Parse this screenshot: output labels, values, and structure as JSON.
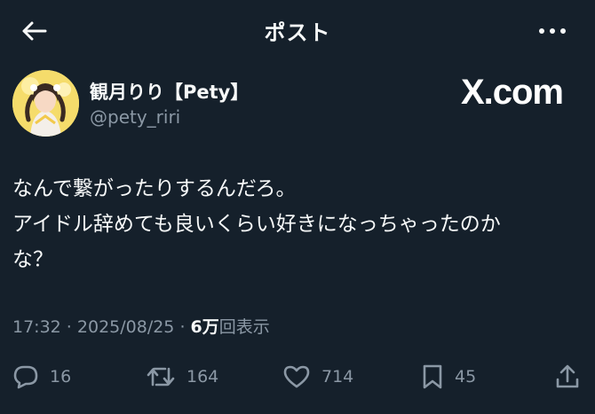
{
  "header": {
    "title": "ポスト",
    "back_icon": "arrow-left-icon",
    "more_icon": "more-horizontal-icon"
  },
  "author": {
    "display_name": "観月りり【Pety】",
    "handle": "@pety_riri",
    "watermark": "X.com"
  },
  "post": {
    "lines": [
      "なんで繋がったりするんだろ。",
      "アイドル辞めても良いくらい好きになっちゃったのか",
      "な？"
    ]
  },
  "meta": {
    "time": "17:32",
    "separator": " · ",
    "date": "2025/08/25",
    "views_count": "6万",
    "views_label": "回表示"
  },
  "actions": {
    "replies": "16",
    "reposts": "164",
    "likes": "714",
    "bookmarks": "45"
  },
  "colors": {
    "background": "#15202b",
    "text": "#f7f9f9",
    "secondary": "#8b98a5"
  }
}
